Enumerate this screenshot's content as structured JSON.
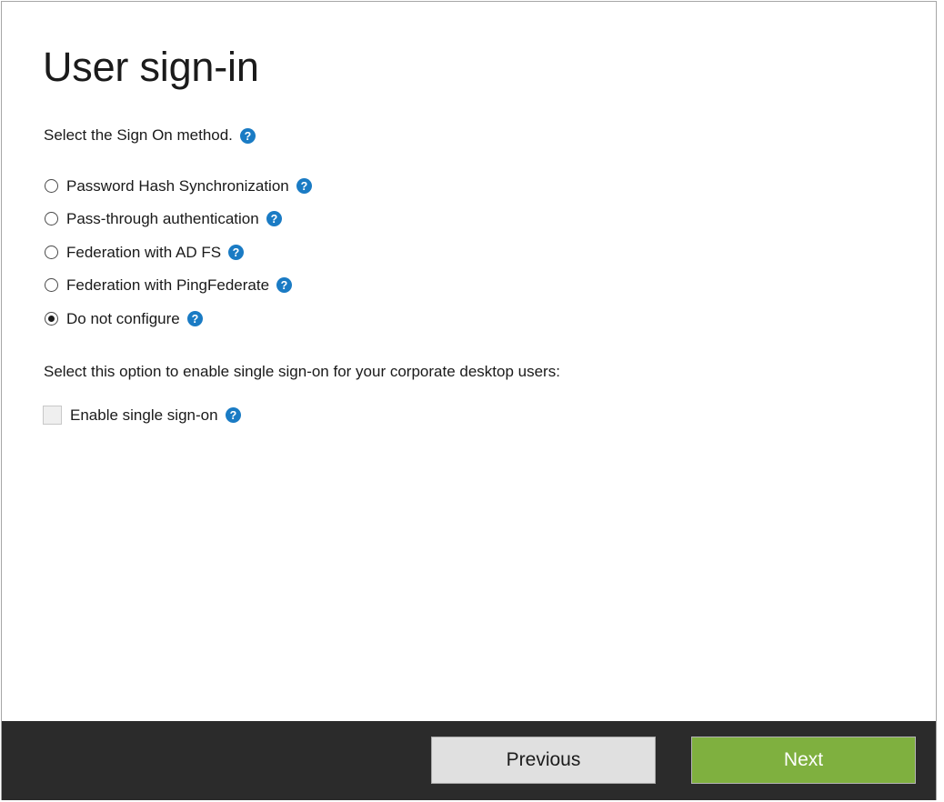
{
  "window": {
    "title": "User sign-in"
  },
  "content": {
    "prompt": "Select the Sign On method.",
    "prompt_help_icon": "help-icon",
    "options": [
      {
        "label": "Password Hash Synchronization",
        "selected": false,
        "help_icon": "help-icon"
      },
      {
        "label": "Pass-through authentication",
        "selected": false,
        "help_icon": "help-icon"
      },
      {
        "label": "Federation with AD FS",
        "selected": false,
        "help_icon": "help-icon"
      },
      {
        "label": "Federation with PingFederate",
        "selected": false,
        "help_icon": "help-icon"
      },
      {
        "label": "Do not configure",
        "selected": true,
        "help_icon": "help-icon"
      }
    ],
    "sso": {
      "instruction": "Select this option to enable single sign-on for your corporate desktop users:",
      "checkbox_label": "Enable single sign-on",
      "checkbox_checked": false,
      "checkbox_enabled": false,
      "help_icon": "help-icon"
    }
  },
  "footer": {
    "previous_label": "Previous",
    "next_label": "Next"
  },
  "colors": {
    "accent_help_blue": "#1a7bc4",
    "next_button_green": "#7fb03f",
    "footer_background": "#2b2b2b",
    "previous_button_grey": "#e0e0e0",
    "text_primary": "#1a1a1a",
    "window_border": "#a6a6a6"
  }
}
